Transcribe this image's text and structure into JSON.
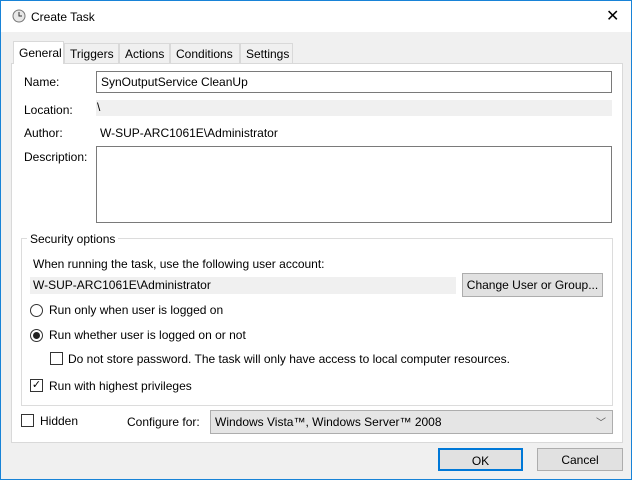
{
  "title": "Create Task",
  "tabs": [
    "General",
    "Triggers",
    "Actions",
    "Conditions",
    "Settings"
  ],
  "general": {
    "name_label": "Name:",
    "name_value": "SynOutputService CleanUp",
    "location_label": "Location:",
    "location_value": "\\",
    "author_label": "Author:",
    "author_value": "W-SUP-ARC1061E\\Administrator",
    "description_label": "Description:",
    "description_value": ""
  },
  "security": {
    "legend": "Security options",
    "account_prompt": "When running the task, use the following user account:",
    "account_value": "W-SUP-ARC1061E\\Administrator",
    "change_button": "Change User or Group...",
    "radio_logged_on": "Run only when user is logged on",
    "radio_whether": "Run whether user is logged on or not",
    "no_store_password": "Do not store password.  The task will only have access to local computer resources.",
    "highest_privileges": "Run with highest privileges",
    "selected_radio": "whether",
    "no_store_checked": false,
    "highest_checked": true
  },
  "hidden_label": "Hidden",
  "hidden_checked": false,
  "configure_label": "Configure for:",
  "configure_value": "Windows Vista™, Windows Server™ 2008",
  "ok": "OK",
  "cancel": "Cancel"
}
